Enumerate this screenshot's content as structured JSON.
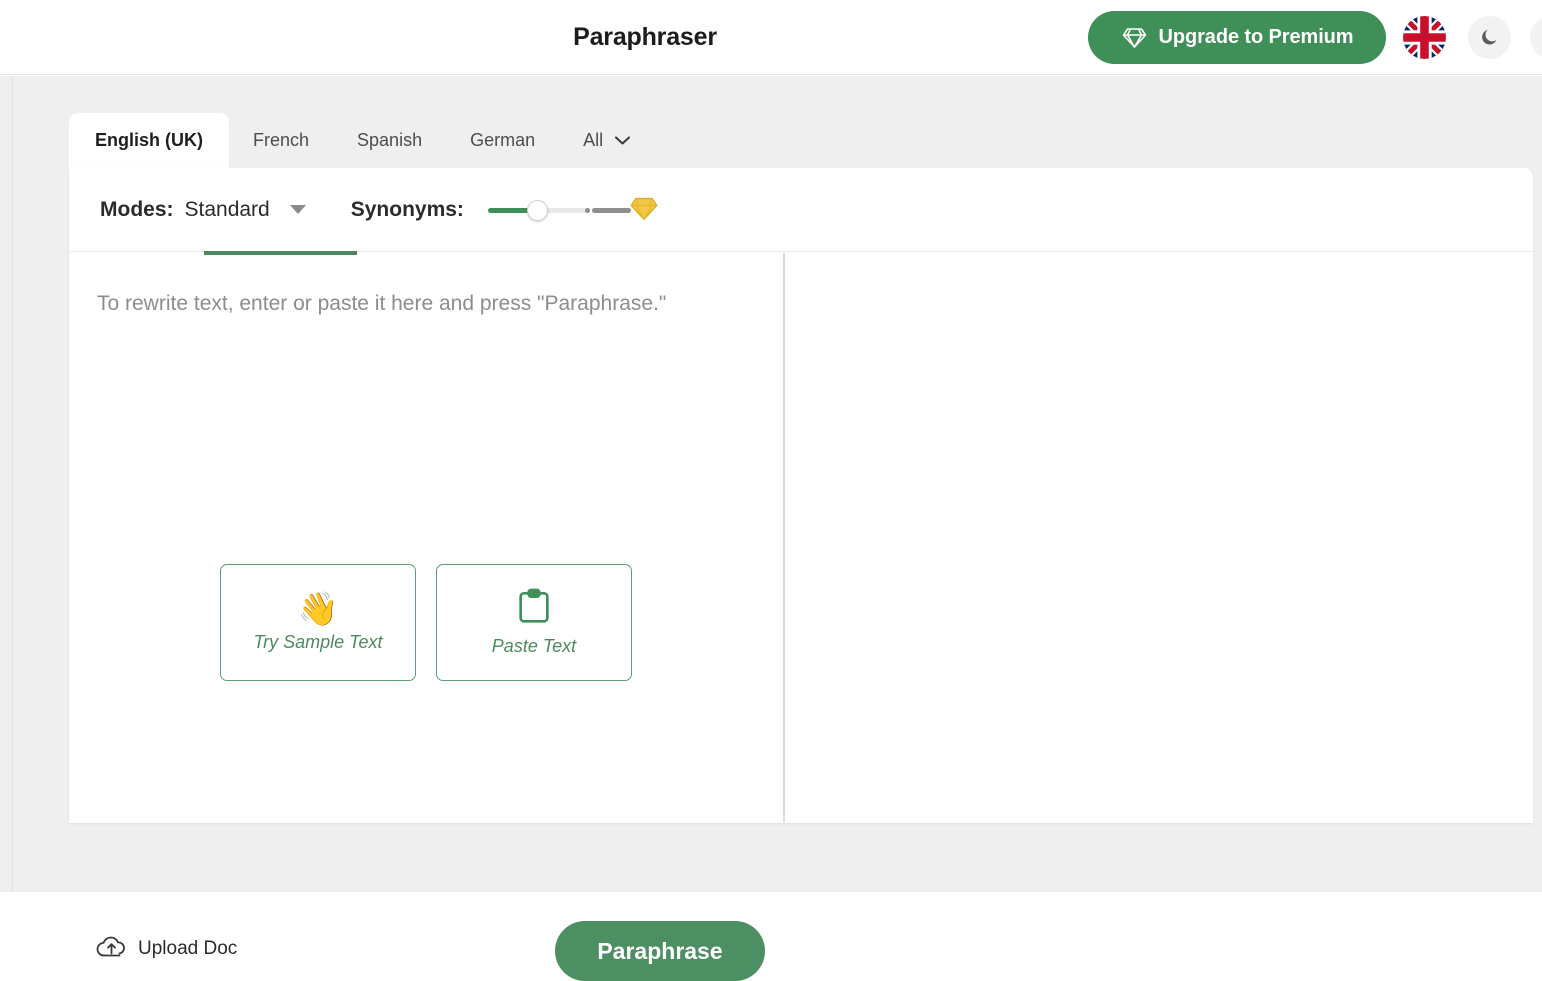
{
  "header": {
    "title": "Paraphraser",
    "upgrade_label": "Upgrade to Premium",
    "upgrade_icon": "gem-icon",
    "flag_icon": "uk-flag-icon",
    "dark_mode_icon": "moon-icon",
    "accent_green": "#3f8f58"
  },
  "tabs": [
    {
      "label": "English (UK)",
      "active": true
    },
    {
      "label": "French",
      "active": false
    },
    {
      "label": "Spanish",
      "active": false
    },
    {
      "label": "German",
      "active": false
    },
    {
      "label": "All",
      "active": false,
      "icon": "chevron-down-icon"
    }
  ],
  "toolbar": {
    "modes_label": "Modes:",
    "mode_value": "Standard",
    "mode_caret_icon": "caret-down-icon",
    "synonyms_label": "Synonyms:",
    "synonyms_gem_icon": "gem-premium-icon",
    "underline_color": "#4c8a5e"
  },
  "input_pane": {
    "placeholder": "To rewrite text, enter or paste it here and press \"Paraphrase.\"",
    "actions": [
      {
        "label": "Try Sample Text",
        "icon": "waving-hand-icon",
        "glyph": "👋"
      },
      {
        "label": "Paste Text",
        "icon": "clipboard-icon"
      }
    ],
    "upload_label": "Upload Doc",
    "upload_icon": "cloud-upload-icon",
    "paraphrase_label": "Paraphrase"
  },
  "output_pane": {
    "content": ""
  }
}
